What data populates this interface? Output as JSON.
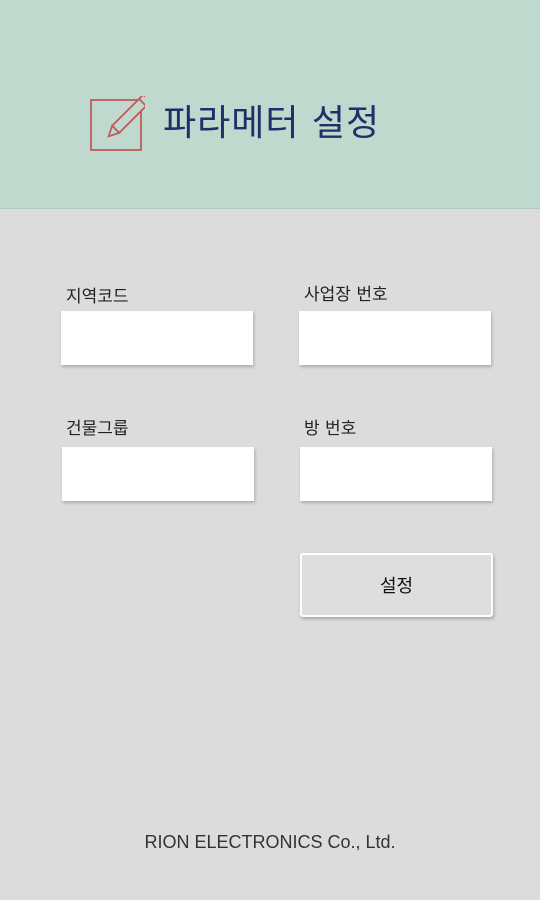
{
  "header": {
    "title": "파라메터 설정",
    "icon": "edit-pencil-icon",
    "background": "#bfd9ce",
    "title_color": "#1e2f6a",
    "icon_color": "#c05c5c"
  },
  "form": {
    "region_code": {
      "label": "지역코드",
      "value": ""
    },
    "business_number": {
      "label": "사업장 번호",
      "value": ""
    },
    "building_group": {
      "label": "건물그룹",
      "value": ""
    },
    "room_number": {
      "label": "방 번호",
      "value": ""
    },
    "submit_label": "설정"
  },
  "footer": {
    "company": "RION ELECTRONICS Co., Ltd."
  }
}
